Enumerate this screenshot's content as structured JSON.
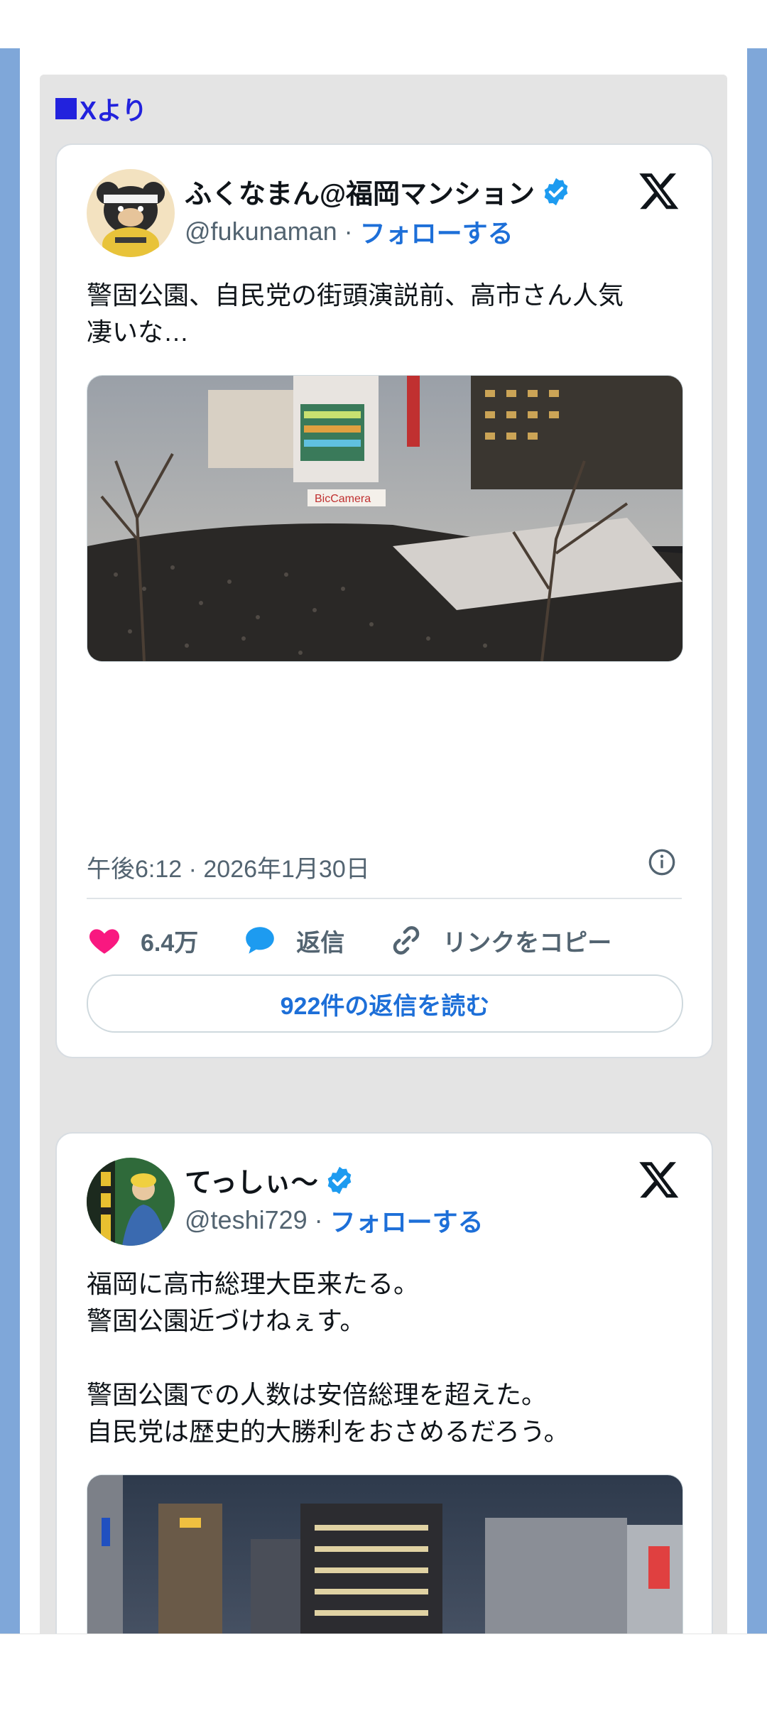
{
  "section_header": "Xより",
  "tweets": [
    {
      "display_name": "ふくなまん@福岡マンション",
      "handle": "@fukunaman",
      "follow_label": "フォローする",
      "text_lines": [
        "警固公園、自民党の街頭演説前、高市さん人気",
        "凄いな…"
      ],
      "timestamp": "午後6:12 · 2026年1月30日",
      "likes": "6.4万",
      "reply_label": "返信",
      "copy_link_label": "リンクをコピー",
      "read_replies_label": "922件の返信を読む",
      "image_sign": "BicCamera"
    },
    {
      "display_name": "てっしぃ〜",
      "handle": "@teshi729",
      "follow_label": "フォローする",
      "text_lines": [
        "福岡に高市総理大臣来たる。",
        "警固公園近づけねぇす。",
        "",
        "警固公園での人数は安倍総理を超えた。",
        "自民党は歴史的大勝利をおさめるだろう。"
      ]
    }
  ],
  "colors": {
    "accent_blue": "#1d6fd8",
    "heart": "#f91880",
    "reply_bubble": "#1d9bf0",
    "side_bar": "#7fa7d9"
  }
}
